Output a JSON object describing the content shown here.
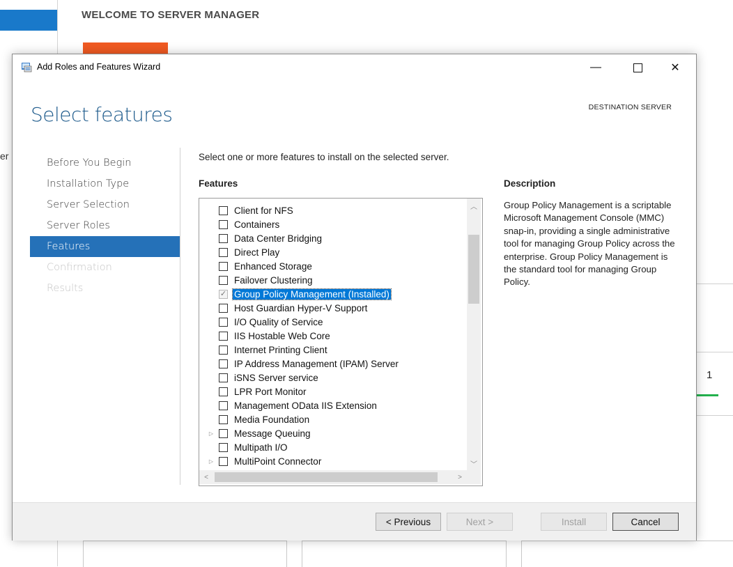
{
  "background": {
    "header_title": "WELCOME TO SERVER MANAGER",
    "side_text": "er",
    "right_tile_number": "1"
  },
  "window": {
    "title": "Add Roles and Features Wizard",
    "minimize_glyph": "—",
    "close_glyph": "✕"
  },
  "page": {
    "heading": "Select features",
    "destination_label": "DESTINATION SERVER",
    "destination_server": "",
    "instruction": "Select one or more features to install on the selected server.",
    "features_label": "Features",
    "description_label": "Description",
    "description_text": "Group Policy Management is a scriptable Microsoft Management Console (MMC) snap-in, providing a single administrative tool for managing Group Policy across the enterprise. Group Policy Management is the standard tool for managing Group Policy."
  },
  "nav": {
    "items": [
      {
        "label": "Before You Begin",
        "state": "normal"
      },
      {
        "label": "Installation Type",
        "state": "normal"
      },
      {
        "label": "Server Selection",
        "state": "normal"
      },
      {
        "label": "Server Roles",
        "state": "normal"
      },
      {
        "label": "Features",
        "state": "active"
      },
      {
        "label": "Confirmation",
        "state": "disabled"
      },
      {
        "label": "Results",
        "state": "disabled"
      }
    ]
  },
  "features": [
    {
      "label": "Client for NFS",
      "checked": false,
      "installed": false,
      "expandable": false,
      "selected": false
    },
    {
      "label": "Containers",
      "checked": false,
      "installed": false,
      "expandable": false,
      "selected": false
    },
    {
      "label": "Data Center Bridging",
      "checked": false,
      "installed": false,
      "expandable": false,
      "selected": false
    },
    {
      "label": "Direct Play",
      "checked": false,
      "installed": false,
      "expandable": false,
      "selected": false
    },
    {
      "label": "Enhanced Storage",
      "checked": false,
      "installed": false,
      "expandable": false,
      "selected": false
    },
    {
      "label": "Failover Clustering",
      "checked": false,
      "installed": false,
      "expandable": false,
      "selected": false
    },
    {
      "label": "Group Policy Management (Installed)",
      "checked": true,
      "installed": true,
      "expandable": false,
      "selected": true
    },
    {
      "label": "Host Guardian Hyper-V Support",
      "checked": false,
      "installed": false,
      "expandable": false,
      "selected": false
    },
    {
      "label": "I/O Quality of Service",
      "checked": false,
      "installed": false,
      "expandable": false,
      "selected": false
    },
    {
      "label": "IIS Hostable Web Core",
      "checked": false,
      "installed": false,
      "expandable": false,
      "selected": false
    },
    {
      "label": "Internet Printing Client",
      "checked": false,
      "installed": false,
      "expandable": false,
      "selected": false
    },
    {
      "label": "IP Address Management (IPAM) Server",
      "checked": false,
      "installed": false,
      "expandable": false,
      "selected": false
    },
    {
      "label": "iSNS Server service",
      "checked": false,
      "installed": false,
      "expandable": false,
      "selected": false
    },
    {
      "label": "LPR Port Monitor",
      "checked": false,
      "installed": false,
      "expandable": false,
      "selected": false
    },
    {
      "label": "Management OData IIS Extension",
      "checked": false,
      "installed": false,
      "expandable": false,
      "selected": false
    },
    {
      "label": "Media Foundation",
      "checked": false,
      "installed": false,
      "expandable": false,
      "selected": false
    },
    {
      "label": "Message Queuing",
      "checked": false,
      "installed": false,
      "expandable": true,
      "selected": false
    },
    {
      "label": "Multipath I/O",
      "checked": false,
      "installed": false,
      "expandable": false,
      "selected": false
    },
    {
      "label": "MultiPoint Connector",
      "checked": false,
      "installed": false,
      "expandable": true,
      "selected": false
    }
  ],
  "scroll": {
    "up": "︿",
    "down": "﹀",
    "left": "<",
    "right": ">"
  },
  "buttons": {
    "previous": "< Previous",
    "next": "Next >",
    "install": "Install",
    "cancel": "Cancel"
  },
  "colors": {
    "accent": "#2571b8",
    "selection": "#0078d7",
    "orange_tile": "#f05a22",
    "green_indicator": "#23b14d"
  }
}
